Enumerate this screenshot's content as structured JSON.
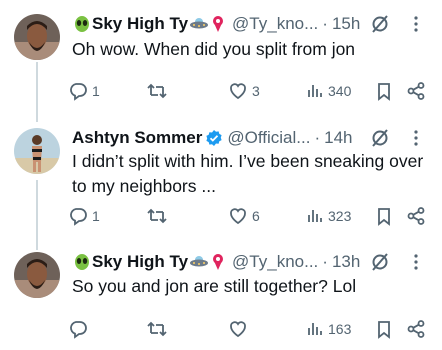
{
  "tweets": [
    {
      "display_name": "Sky High Ty",
      "name_emojis": [
        "alien-emoji",
        "ufo-emoji",
        "pin-emoji"
      ],
      "handle": "@Ty_kno...",
      "dot": "·",
      "time": "15h",
      "text": "Oh wow. When did you split from jon",
      "replies": "1",
      "retweets": "",
      "likes": "3",
      "views": "340"
    },
    {
      "display_name": "Ashtyn Sommer",
      "verified": true,
      "handle": "@Official...",
      "dot": "·",
      "time": "14h",
      "text": "I didn’t split with him. I’ve been sneaking over to my neighbors ...",
      "replies": "1",
      "retweets": "",
      "likes": "6",
      "views": "323"
    },
    {
      "display_name": "Sky High Ty",
      "name_emojis": [
        "alien-emoji",
        "ufo-emoji",
        "pin-emoji"
      ],
      "handle": "@Ty_kno...",
      "dot": "·",
      "time": "13h",
      "text": "So you and jon are still together? Lol",
      "replies": "",
      "retweets": "",
      "likes": "",
      "views": "163"
    }
  ],
  "colors": {
    "text": "#0f1419",
    "secondary": "#536471",
    "thread_line": "#cfd9de",
    "verified": "#1d9bf0"
  }
}
